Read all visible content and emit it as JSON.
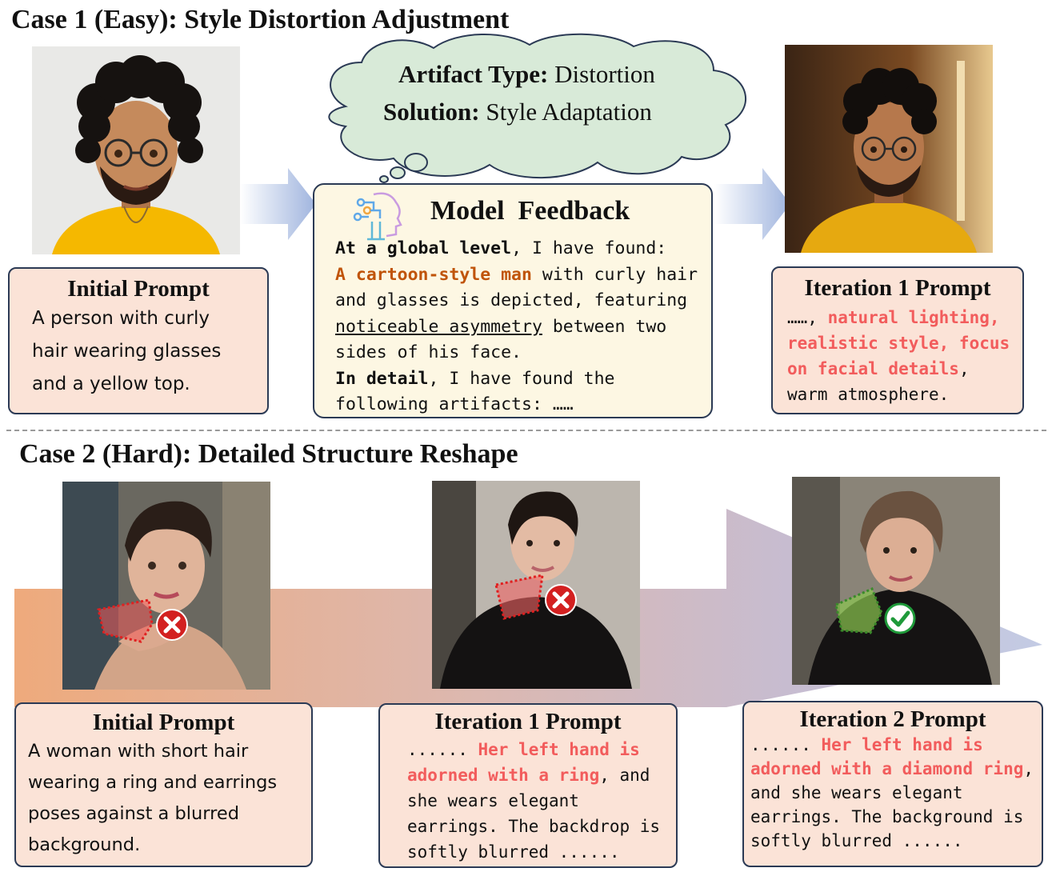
{
  "case1": {
    "title": "Case 1 (Easy): Style Distortion Adjustment",
    "thought_cloud": {
      "artifact_label": "Artifact Type:",
      "artifact_value": "Distortion",
      "solution_label": "Solution:",
      "solution_value": "Style Adaptation"
    },
    "feedback": {
      "title": "Model  Feedback",
      "line1_bold": "At a global level",
      "line1_rest": ", I have found:",
      "highlight": "A cartoon-style man",
      "line2_rest": " with curly hair and glasses is depicted, featuring ",
      "underlined": "noticeable asymmetry",
      "line3_rest": " between two sides of his face.",
      "detail_bold": "In detail",
      "detail_rest": ", I have found the following artifacts: ……"
    },
    "initial_prompt": {
      "title": "Initial Prompt",
      "text": "A person with curly\nhair wearing glasses\nand a yellow top."
    },
    "iteration1_prompt": {
      "title": "Iteration 1 Prompt",
      "prefix": "……, ",
      "highlight": "natural lighting, realistic style, focus on facial details",
      "suffix": ", warm atmosphere."
    }
  },
  "case2": {
    "title": "Case 2 (Hard): Detailed Structure Reshape",
    "initial_prompt": {
      "title": "Initial Prompt",
      "text": "A woman with short hair\nwearing a ring and earrings\nposes against a blurred\nbackground."
    },
    "iteration1_prompt": {
      "title": "Iteration 1 Prompt",
      "prefix": "...... ",
      "highlight": "Her left hand is adorned with a ring",
      "suffix": ", and she wears elegant earrings. The backdrop is softly blurred ......"
    },
    "iteration2_prompt": {
      "title": "Iteration 2 Prompt",
      "prefix": "...... ",
      "highlight": "Her left hand is adorned with a diamond ring",
      "suffix": ", and she wears elegant earrings. The background is softly blurred ......"
    }
  },
  "colors": {
    "prompt_box": "#fbe3d7",
    "feedback_box": "#fdf7e3",
    "cloud": "#d8ead8",
    "highlight_red": "#f25c5c",
    "highlight_orange": "#c0540a",
    "cross": "#d32020",
    "check": "#1f9a3a"
  }
}
